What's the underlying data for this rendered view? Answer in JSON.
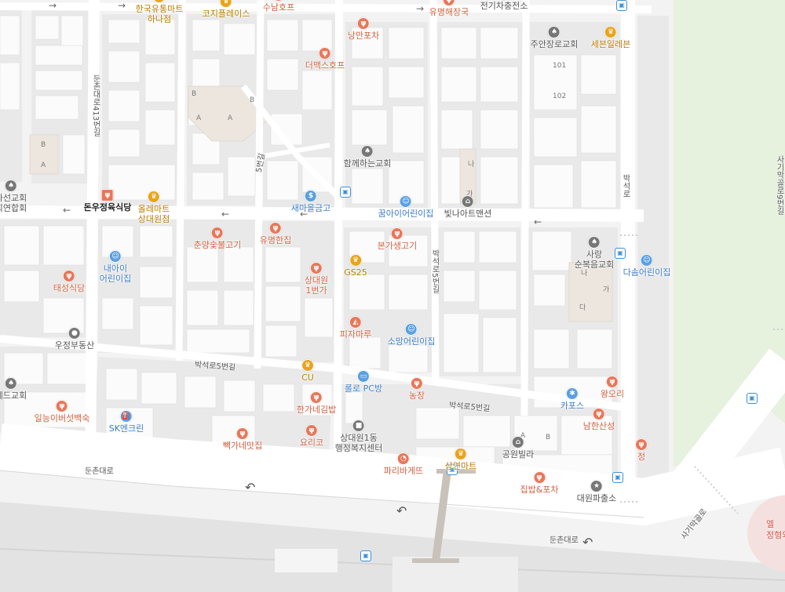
{
  "map": {
    "colors": {
      "background": "#f3f3f3",
      "block": "#e8e8e8",
      "building": "#fafafa",
      "park": "#e6f1de",
      "road": "#ffffff"
    },
    "pois": [
      {
        "id": "hanguk-yutong",
        "label": "한국유통마트\n하나점",
        "kind": "shop",
        "icon": "crown-icon"
      },
      {
        "id": "korea-place",
        "label": "코지플레이스",
        "kind": "shop",
        "icon": "crown-icon"
      },
      {
        "id": "sunam",
        "label": "수남호프",
        "kind": "food",
        "icon": "fork-knife-icon"
      },
      {
        "id": "yumyeong-haejangguk",
        "label": "유명해장국",
        "kind": "food",
        "icon": "fork-knife-icon"
      },
      {
        "id": "ev-charger",
        "label": "전기차충전소",
        "kind": "gray",
        "icon": "bolt-icon"
      },
      {
        "id": "nangman-pocha",
        "label": "낭만포차",
        "kind": "food",
        "icon": "fork-knife-icon"
      },
      {
        "id": "the-max",
        "label": "더맥스호프",
        "kind": "food",
        "icon": "fork-knife-icon"
      },
      {
        "id": "juan-church",
        "label": "주안장로교회",
        "kind": "gray",
        "icon": "church-icon"
      },
      {
        "id": "seven-eleven",
        "label": "세븐일레븐",
        "kind": "shop",
        "icon": "crown-icon"
      },
      {
        "id": "hamkke-church",
        "label": "함께하는교회",
        "kind": "gray",
        "icon": "church-icon"
      },
      {
        "id": "kkumai",
        "label": "꿈아이어린이집",
        "kind": "edu",
        "icon": "kids-icon"
      },
      {
        "id": "bitna-art",
        "label": "빛나아트맨션",
        "kind": "gray",
        "icon": "house-icon"
      },
      {
        "id": "saemaeul",
        "label": "새마을금고",
        "kind": "edu",
        "icon": "bank-icon"
      },
      {
        "id": "olle-mart",
        "label": "올레마트\n상대원점",
        "kind": "shop",
        "icon": "crown-icon"
      },
      {
        "id": "donwoo",
        "label": "돈우정육식당",
        "kind": "blk",
        "icon": "restaurant-icon"
      },
      {
        "id": "church-left",
        "label": "라선교회\n회연합회",
        "kind": "gray",
        "icon": "church-icon"
      },
      {
        "id": "chunyang",
        "label": "춘양숯불고기",
        "kind": "food",
        "icon": "fork-knife-icon"
      },
      {
        "id": "yumyeong-hanjip",
        "label": "유명한집",
        "kind": "food",
        "icon": "fork-knife-icon"
      },
      {
        "id": "bonga",
        "label": "본가생고기",
        "kind": "food",
        "icon": "fork-knife-icon"
      },
      {
        "id": "sarang-church",
        "label": "사랑\n순복음교회",
        "kind": "gray",
        "icon": "church-icon"
      },
      {
        "id": "dasom",
        "label": "다솜어린이집",
        "kind": "edu",
        "icon": "kids-icon"
      },
      {
        "id": "naai",
        "label": "내아이\n어린이집",
        "kind": "edu",
        "icon": "kids-icon"
      },
      {
        "id": "gs25",
        "label": "GS25",
        "kind": "shop",
        "icon": "crown-icon"
      },
      {
        "id": "sangdaewon-1",
        "label": "상대원\n1번가",
        "kind": "food",
        "icon": "fork-knife-icon"
      },
      {
        "id": "taeseong",
        "label": "태성식당",
        "kind": "food",
        "icon": "fork-knife-icon"
      },
      {
        "id": "pizza-maru",
        "label": "피자마루",
        "kind": "food",
        "icon": "pizza-icon"
      },
      {
        "id": "somang",
        "label": "소망어린이집",
        "kind": "edu",
        "icon": "kids-icon"
      },
      {
        "id": "ujeong",
        "label": "우정부동산",
        "kind": "gray",
        "icon": "realestate-icon"
      },
      {
        "id": "cu",
        "label": "CU",
        "kind": "shop",
        "icon": "crown-icon"
      },
      {
        "id": "rollo",
        "label": "롤로 PC방",
        "kind": "edu",
        "icon": "pc-icon"
      },
      {
        "id": "nongjang",
        "label": "농장",
        "kind": "food",
        "icon": "fork-knife-icon"
      },
      {
        "id": "wangori",
        "label": "왕오리",
        "kind": "food",
        "icon": "fork-knife-icon"
      },
      {
        "id": "kapos",
        "label": "카포스",
        "kind": "edu",
        "icon": "wrench-icon"
      },
      {
        "id": "namhan",
        "label": "남한산성",
        "kind": "food",
        "icon": "fork-knife-icon"
      },
      {
        "id": "church-sw",
        "label": "세드교회",
        "kind": "gray",
        "icon": "church-icon"
      },
      {
        "id": "ilneung",
        "label": "일능이버섯백숙",
        "kind": "food",
        "icon": "fork-knife-icon"
      },
      {
        "id": "hangane",
        "label": "한가네김밥",
        "kind": "food",
        "icon": "fork-knife-icon"
      },
      {
        "id": "sk-enclean",
        "label": "SK엔크린",
        "kind": "edu",
        "icon": "gas-icon"
      },
      {
        "id": "yorico",
        "label": "요리코",
        "kind": "food",
        "icon": "fork-knife-icon"
      },
      {
        "id": "ppakgane",
        "label": "빽가네맛집",
        "kind": "food",
        "icon": "fork-knife-icon"
      },
      {
        "id": "welfare-center",
        "label": "상대원1동\n행정복지센터",
        "kind": "gray",
        "icon": "office-icon"
      },
      {
        "id": "paris",
        "label": "파리바게뜨",
        "kind": "food",
        "icon": "bakery-icon"
      },
      {
        "id": "sangyeon-mart",
        "label": "상연마트",
        "kind": "shop",
        "icon": "crown-icon"
      },
      {
        "id": "gongwon-villa",
        "label": "공원빌라",
        "kind": "gray",
        "icon": "house-icon"
      },
      {
        "id": "jipbap",
        "label": "집밥&포차",
        "kind": "food",
        "icon": "fork-knife-icon"
      },
      {
        "id": "police",
        "label": "대원파출소",
        "kind": "gray",
        "icon": "police-icon"
      },
      {
        "id": "jeong",
        "label": "정",
        "kind": "food",
        "icon": "fork-knife-icon"
      }
    ],
    "streets": [
      {
        "id": "dunchon-413",
        "label": "둔촌대로413번길"
      },
      {
        "id": "baekseok-5-a",
        "label": "5번길"
      },
      {
        "id": "baekseok-5-vert",
        "label": "박석로5번길"
      },
      {
        "id": "baekseok-ro",
        "label": "박석로"
      },
      {
        "id": "sagimak",
        "label": "사기막골로9번길"
      },
      {
        "id": "baekseok-5-h1",
        "label": "박석로5번길"
      },
      {
        "id": "baekseok-5-h2",
        "label": "박석로5번길"
      },
      {
        "id": "dunchon-1",
        "label": "둔촌대로"
      },
      {
        "id": "dunchon-2",
        "label": "둔촌대로"
      },
      {
        "id": "sagimak-diag",
        "label": "사기막골로"
      }
    ],
    "building_labels": [
      "B",
      "A",
      "B",
      "A",
      "A",
      "B",
      "나",
      "가",
      "101",
      "102",
      "나",
      "가",
      "다",
      "A",
      "B"
    ],
    "corner_label": "엘\n정형외"
  }
}
